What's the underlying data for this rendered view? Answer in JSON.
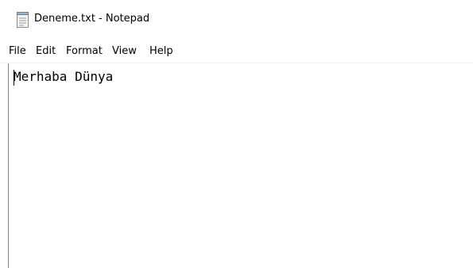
{
  "window": {
    "title": "Deneme.txt - Notepad",
    "icon": "notepad-icon"
  },
  "menu": {
    "items": [
      {
        "label": "File"
      },
      {
        "label": "Edit"
      },
      {
        "label": "Format"
      },
      {
        "label": "View"
      },
      {
        "label": "Help"
      }
    ]
  },
  "editor": {
    "content": "Merhaba Dünya"
  },
  "colors": {
    "background": "#ffffff",
    "text": "#000000",
    "border": "#808080"
  }
}
